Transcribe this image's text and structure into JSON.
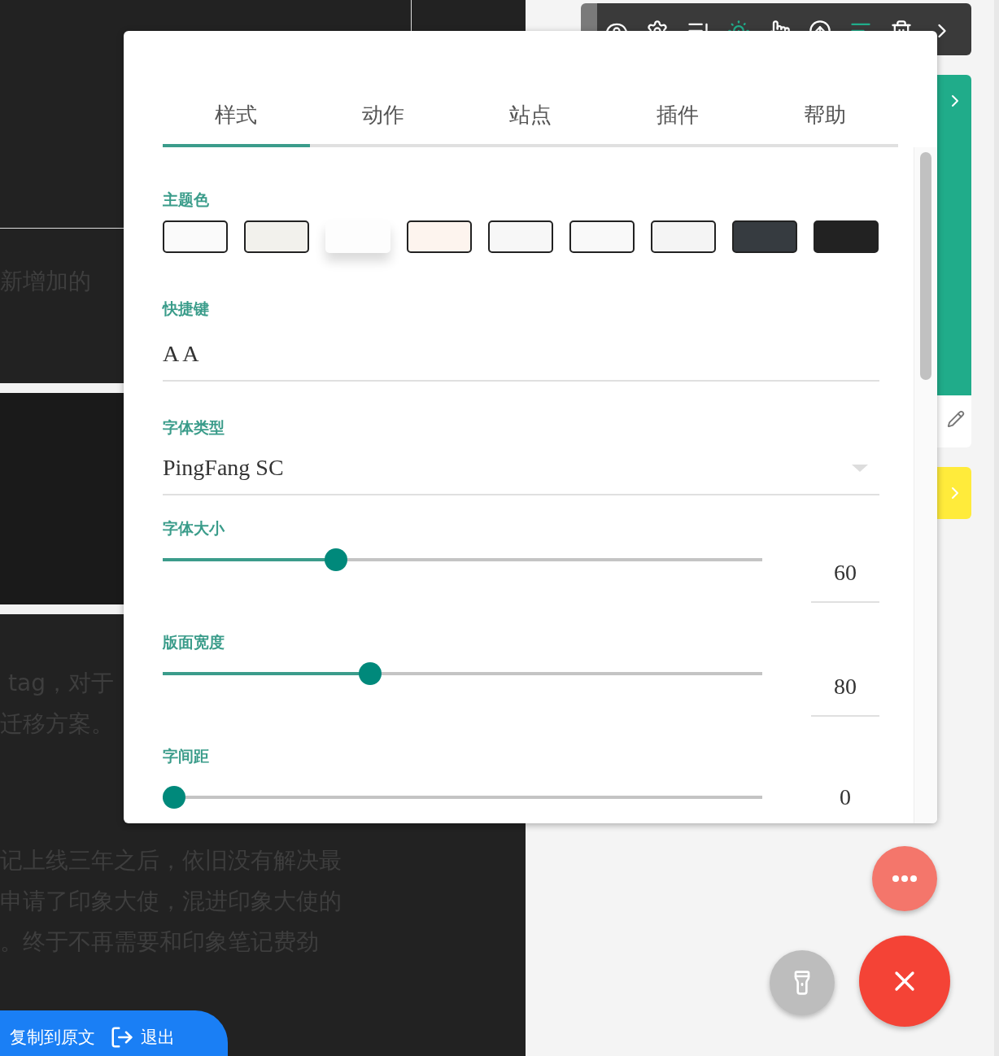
{
  "background": {
    "text_lines": [
      "新增加的",
      "tag，对于",
      "迁移方案。",
      "记上线三年之后，依旧没有解决最",
      "申请了印象大使，混进印象大使的",
      "。终于不再需要和印象笔记费劲"
    ],
    "bottom_bar": {
      "copy_label": "复制到原文",
      "exit_label": "退出"
    }
  },
  "dialog": {
    "tabs": [
      {
        "label": "样式",
        "selected": true
      },
      {
        "label": "动作",
        "selected": false
      },
      {
        "label": "站点",
        "selected": false
      },
      {
        "label": "插件",
        "selected": false
      },
      {
        "label": "帮助",
        "selected": false
      }
    ],
    "theme": {
      "label": "主题色",
      "swatches": [
        {
          "color": "#fafafa",
          "selected": false
        },
        {
          "color": "#f2f1ec",
          "selected": false
        },
        {
          "color": "#fdfdfd",
          "selected": true
        },
        {
          "color": "#fdf4ee",
          "selected": false
        },
        {
          "color": "#f7f7f7",
          "selected": false
        },
        {
          "color": "#f9f9f9",
          "selected": false
        },
        {
          "color": "#f4f4f4",
          "selected": false
        },
        {
          "color": "#363b40",
          "selected": false
        },
        {
          "color": "#222222",
          "selected": false
        }
      ]
    },
    "shortcut": {
      "label": "快捷键",
      "value": "A A"
    },
    "font_family": {
      "label": "字体类型",
      "value": "PingFang SC"
    },
    "sliders": [
      {
        "label": "字体大小",
        "level": 0.28,
        "reading": "60"
      },
      {
        "label": "版面宽度",
        "level": 0.34,
        "reading": "80"
      },
      {
        "label": "字间距",
        "level": 0,
        "reading": "0"
      }
    ]
  }
}
